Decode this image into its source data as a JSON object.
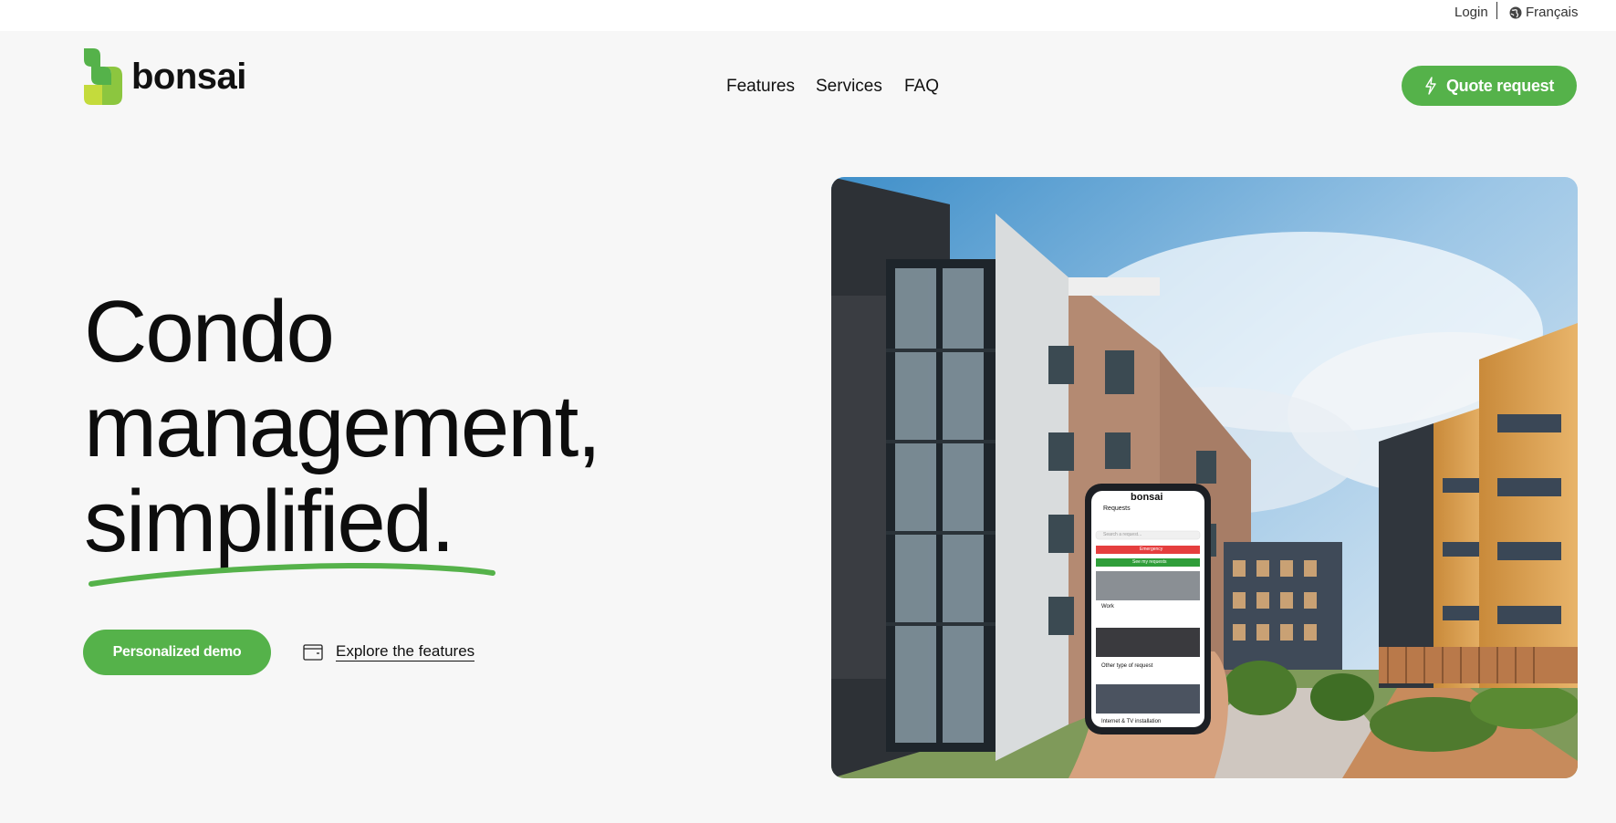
{
  "topbar": {
    "login": "Login",
    "language": "Français"
  },
  "brand": {
    "name": "bonsai",
    "colors": {
      "primary": "#55b24a",
      "leaf_light": "#c4db3c",
      "leaf_mid": "#8cc63f"
    }
  },
  "nav": {
    "items": [
      "Features",
      "Services",
      "FAQ"
    ]
  },
  "header": {
    "quote_label": "Quote request",
    "quote_icon": "lightning-icon"
  },
  "hero": {
    "title_lines": [
      "Condo",
      "management,",
      "simplified."
    ],
    "demo_label": "Personalized demo",
    "explore_label": "Explore the features",
    "explore_icon": "window-icon"
  },
  "phone": {
    "brand": "bonsai",
    "screen_title": "Requests",
    "search_placeholder": "Search a request...",
    "emergency_label": "Emergency",
    "see_requests_label": "See my requests",
    "cards": [
      "Work",
      "Other type of request",
      "Internet & TV installation"
    ]
  }
}
